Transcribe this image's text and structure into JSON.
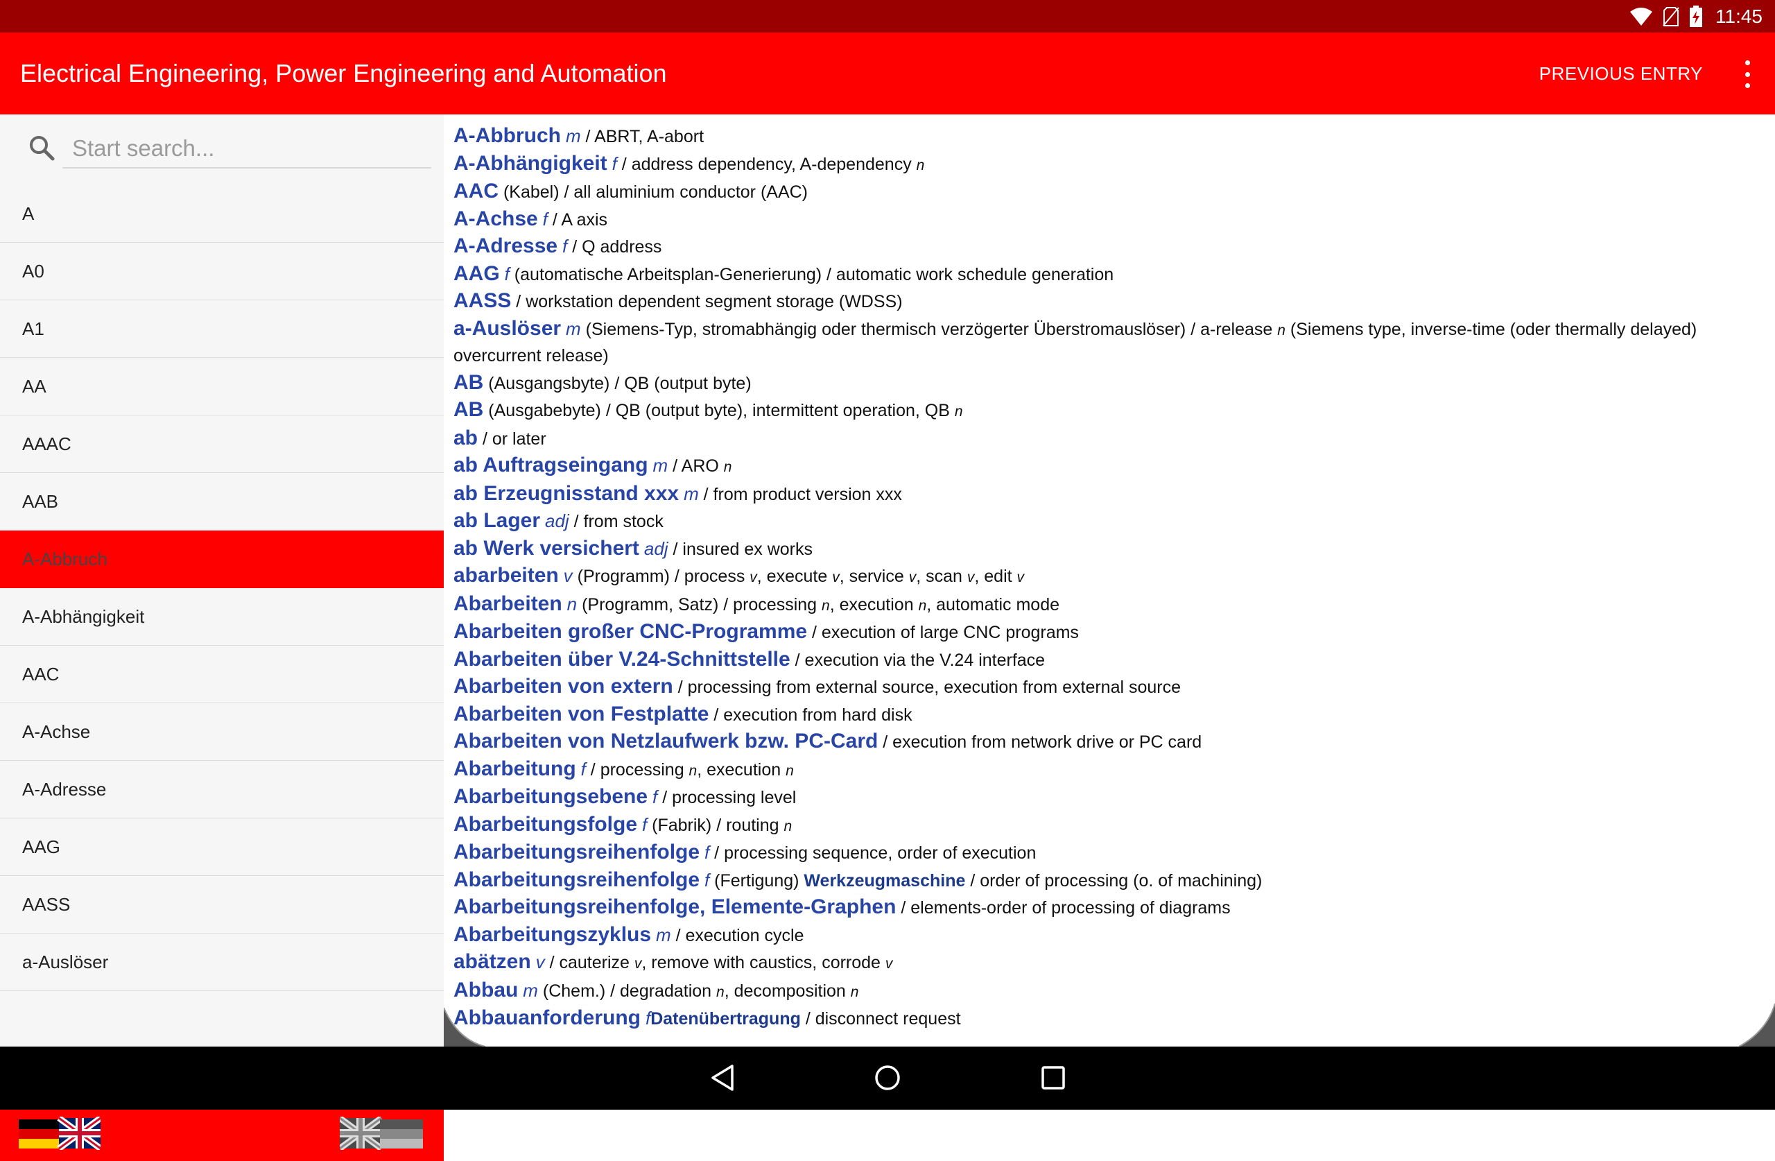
{
  "status_bar": {
    "time": "11:45"
  },
  "toolbar": {
    "title": "Electrical Engineering, Power Engineering and Automation",
    "previous_entry_label": "PREVIOUS ENTRY"
  },
  "search": {
    "placeholder": "Start search..."
  },
  "sidebar": {
    "items": [
      "A",
      "A0",
      "A1",
      "AA",
      "AAAC",
      "AAB",
      "A-Abbruch",
      "A-Abhängigkeit",
      "AAC",
      "A-Achse",
      "A-Adresse",
      "AAG",
      "AASS",
      "a-Auslöser"
    ],
    "selected_index": 6
  },
  "colors": {
    "primary": "#ff0000",
    "status_bar": "#9b0000",
    "headword": "#2845a6"
  },
  "entries": [
    {
      "hw": "A-Abbruch",
      "parts": [
        [
          "g",
          "m"
        ],
        [
          "t",
          " / ABRT, A-abort"
        ]
      ]
    },
    {
      "hw": "A-Abhängigkeit",
      "parts": [
        [
          "g",
          "f"
        ],
        [
          "t",
          " / address dependency, A-dependency "
        ],
        [
          "s",
          "n"
        ]
      ]
    },
    {
      "hw": "AAC",
      "parts": [
        [
          "t",
          " (Kabel) / all aluminium conductor (AAC)"
        ]
      ]
    },
    {
      "hw": "A-Achse",
      "parts": [
        [
          "g",
          "f"
        ],
        [
          "t",
          " / A axis"
        ]
      ]
    },
    {
      "hw": "A-Adresse",
      "parts": [
        [
          "g",
          "f"
        ],
        [
          "t",
          " / Q address"
        ]
      ]
    },
    {
      "hw": "AAG",
      "parts": [
        [
          "g",
          "f"
        ],
        [
          "t",
          " (automatische Arbeitsplan-Generierung) / automatic work schedule generation"
        ]
      ]
    },
    {
      "hw": "AASS",
      "parts": [
        [
          "t",
          " / workstation dependent segment storage (WDSS)"
        ]
      ]
    },
    {
      "hw": "a-Auslöser",
      "parts": [
        [
          "g",
          "m"
        ],
        [
          "t",
          " (Siemens-Typ, stromabhängig oder thermisch verzögerter Überstromauslöser) / a-release "
        ],
        [
          "s",
          "n"
        ],
        [
          "t",
          " (Siemens type, inverse-time (oder thermally delayed) overcurrent release)"
        ]
      ]
    },
    {
      "hw": "AB",
      "parts": [
        [
          "t",
          " (Ausgangsbyte) / QB (output byte)"
        ]
      ]
    },
    {
      "hw": "AB",
      "parts": [
        [
          "t",
          " (Ausgabebyte) / QB (output byte), intermittent operation, QB "
        ],
        [
          "s",
          "n"
        ]
      ]
    },
    {
      "hw": "ab",
      "parts": [
        [
          "t",
          " / or later"
        ]
      ]
    },
    {
      "hw": "ab Auftragseingang",
      "parts": [
        [
          "g",
          "m"
        ],
        [
          "t",
          " / ARO "
        ],
        [
          "s",
          "n"
        ]
      ]
    },
    {
      "hw": "ab Erzeugnisstand xxx",
      "parts": [
        [
          "g",
          "m"
        ],
        [
          "t",
          " / from product version xxx"
        ]
      ]
    },
    {
      "hw": "ab Lager",
      "parts": [
        [
          "g",
          "adj"
        ],
        [
          "t",
          " / from stock"
        ]
      ]
    },
    {
      "hw": "ab Werk versichert",
      "parts": [
        [
          "g",
          "adj"
        ],
        [
          "t",
          " / insured ex works"
        ]
      ]
    },
    {
      "hw": "abarbeiten",
      "parts": [
        [
          "g",
          "v"
        ],
        [
          "t",
          " (Programm) / process "
        ],
        [
          "s",
          "v"
        ],
        [
          "t",
          ", execute "
        ],
        [
          "s",
          "v"
        ],
        [
          "t",
          ", service "
        ],
        [
          "s",
          "v"
        ],
        [
          "t",
          ", scan "
        ],
        [
          "s",
          "v"
        ],
        [
          "t",
          ", edit "
        ],
        [
          "s",
          "v"
        ]
      ]
    },
    {
      "hw": "Abarbeiten",
      "parts": [
        [
          "g",
          "n"
        ],
        [
          "t",
          " (Programm, Satz) / processing "
        ],
        [
          "s",
          "n"
        ],
        [
          "t",
          ", execution "
        ],
        [
          "s",
          "n"
        ],
        [
          "t",
          ", automatic mode"
        ]
      ]
    },
    {
      "hw": "Abarbeiten großer CNC-Programme",
      "parts": [
        [
          "t",
          " / execution of large CNC programs"
        ]
      ]
    },
    {
      "hw": "Abarbeiten über V.24-Schnittstelle",
      "parts": [
        [
          "t",
          " / execution via the V.24 interface"
        ]
      ]
    },
    {
      "hw": "Abarbeiten von extern",
      "parts": [
        [
          "t",
          " / processing from external source, execution from external source"
        ]
      ]
    },
    {
      "hw": "Abarbeiten von Festplatte",
      "parts": [
        [
          "t",
          " / execution from hard disk"
        ]
      ]
    },
    {
      "hw": "Abarbeiten von Netzlaufwerk bzw. PC-Card",
      "parts": [
        [
          "t",
          " / execution from network drive or PC card"
        ]
      ]
    },
    {
      "hw": "Abarbeitung",
      "parts": [
        [
          "g",
          "f"
        ],
        [
          "t",
          " / processing "
        ],
        [
          "s",
          "n"
        ],
        [
          "t",
          ", execution "
        ],
        [
          "s",
          "n"
        ]
      ]
    },
    {
      "hw": "Abarbeitungsebene",
      "parts": [
        [
          "g",
          "f"
        ],
        [
          "t",
          " / processing level"
        ]
      ]
    },
    {
      "hw": "Abarbeitungsfolge",
      "parts": [
        [
          "g",
          "f"
        ],
        [
          "t",
          " (Fabrik) / routing "
        ],
        [
          "s",
          "n"
        ]
      ]
    },
    {
      "hw": "Abarbeitungsreihenfolge",
      "parts": [
        [
          "g",
          "f"
        ],
        [
          "t",
          " / processing sequence, order of execution"
        ]
      ]
    },
    {
      "hw": "Abarbeitungsreihenfolge",
      "parts": [
        [
          "g",
          "f"
        ],
        [
          "t",
          " (Fertigung) "
        ],
        [
          "x",
          "Werkzeugmaschine"
        ],
        [
          "t",
          " / order of processing (o. of machining)"
        ]
      ]
    },
    {
      "hw": "Abarbeitungsreihenfolge, Elemente-Graphen",
      "parts": [
        [
          "t",
          " / elements-order of processing of diagrams"
        ]
      ]
    },
    {
      "hw": "Abarbeitungszyklus",
      "parts": [
        [
          "g",
          "m"
        ],
        [
          "t",
          " / execution cycle"
        ]
      ]
    },
    {
      "hw": "abätzen",
      "parts": [
        [
          "g",
          "v"
        ],
        [
          "t",
          " / cauterize "
        ],
        [
          "s",
          "v"
        ],
        [
          "t",
          ", remove with caustics, corrode "
        ],
        [
          "s",
          "v"
        ]
      ]
    },
    {
      "hw": "Abbau",
      "parts": [
        [
          "g",
          "m"
        ],
        [
          "t",
          " (Chem.) / degradation "
        ],
        [
          "s",
          "n"
        ],
        [
          "t",
          ", decomposition "
        ],
        [
          "s",
          "n"
        ]
      ]
    },
    {
      "hw": "Abbauanforderung",
      "parts": [
        [
          "g",
          "f"
        ],
        [
          "x",
          "Datenübertragung"
        ],
        [
          "t",
          " / disconnect request"
        ]
      ]
    }
  ]
}
